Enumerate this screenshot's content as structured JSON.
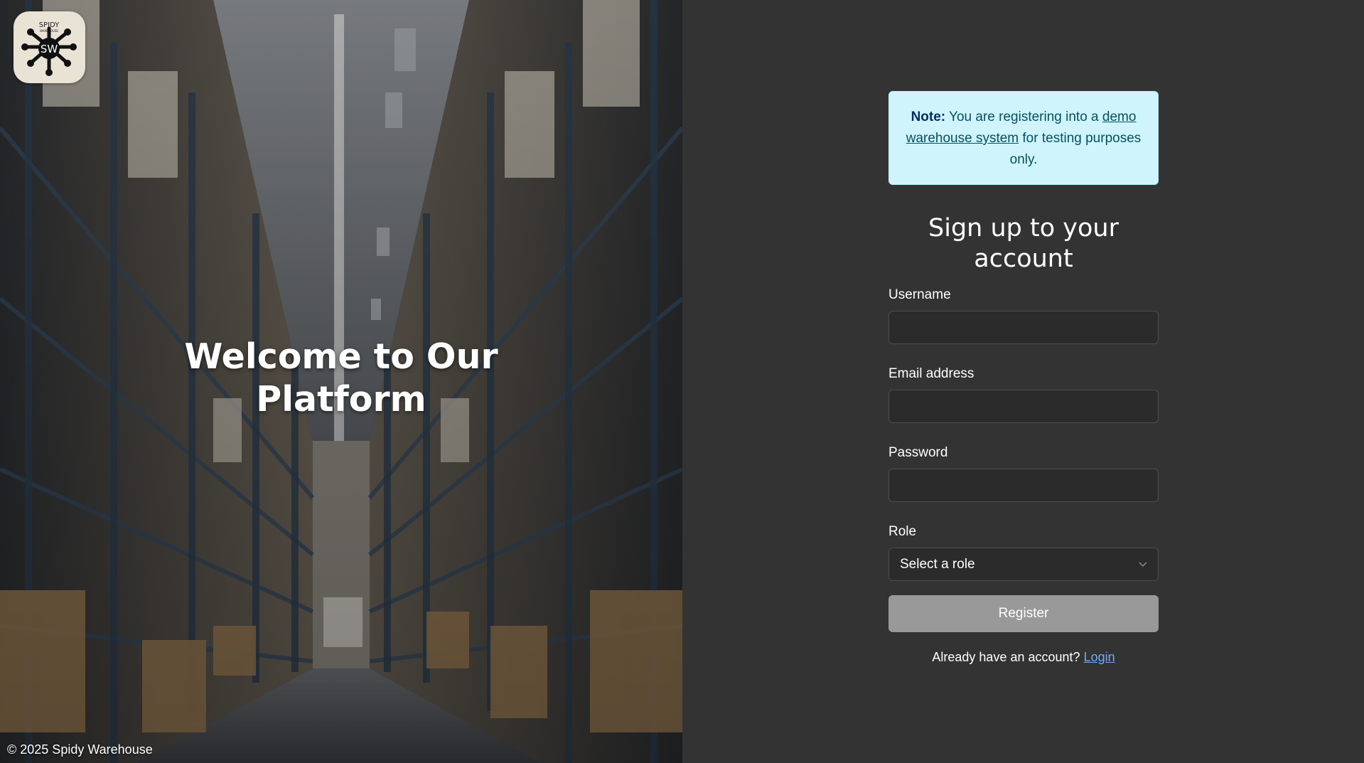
{
  "brand": {
    "logo_top_text": "SPIDY",
    "logo_small_text": "WAREHOUSE",
    "logo_initials": "SW",
    "logo_icon": "spider-logo-icon"
  },
  "hero": {
    "title": "Welcome to Our Platform",
    "copyright": "© 2025 Spidy Warehouse"
  },
  "note": {
    "bold": "Note:",
    "text_before": " You are registering into a ",
    "link": "demo warehouse system",
    "text_after": " for testing purposes only."
  },
  "form": {
    "title": "Sign up to your account",
    "username_label": "Username",
    "username_value": "",
    "email_label": "Email address",
    "email_value": "",
    "password_label": "Password",
    "password_value": "",
    "role_label": "Role",
    "role_selected": "Select a role",
    "register_label": "Register",
    "login_prompt": "Already have an account?",
    "login_link": "Login"
  },
  "colors": {
    "form_background": "#333333",
    "note_background": "#cff4fc",
    "button_background": "#999999",
    "link": "#6ea8fe"
  }
}
